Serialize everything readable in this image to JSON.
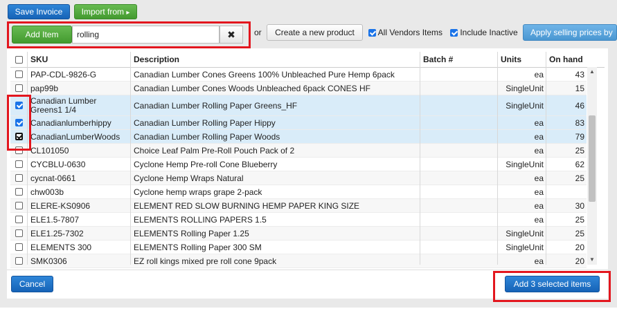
{
  "toolbar": {
    "save_invoice": "Save Invoice",
    "import_from": "Import from",
    "import_caret": "▸"
  },
  "search": {
    "add_item_label": "Add Item",
    "value": "rolling",
    "or_text": "or",
    "create_new_product": "Create a new product",
    "all_vendors_label": "All Vendors Items",
    "all_vendors_checked": true,
    "include_inactive_label": "Include Inactive",
    "include_inactive_checked": true,
    "apply_selling_prices": "Apply selling prices by"
  },
  "table": {
    "columns": [
      "SKU",
      "Description",
      "Batch #",
      "Units",
      "On hand"
    ],
    "rows": [
      {
        "sku": "PAP-CDL-9826-G",
        "description": "Canadian Lumber Cones Greens 100% Unbleached Pure Hemp 6pack",
        "batch": "",
        "units": "ea",
        "on_hand": "43",
        "checked": false,
        "selected": false
      },
      {
        "sku": "pap99b",
        "description": "Canadian Lumber Cones Woods Unbleached 6pack CONES HF",
        "batch": "",
        "units": "SingleUnit",
        "on_hand": "15",
        "checked": false,
        "selected": false
      },
      {
        "sku": "Canadian Lumber Greens1 1/4",
        "description": "Canadian Lumber Rolling Paper Greens_HF",
        "batch": "",
        "units": "SingleUnit",
        "on_hand": "46",
        "checked": true,
        "selected": true
      },
      {
        "sku": "Canadianlumberhippy",
        "description": "Canadian Lumber Rolling Paper Hippy",
        "batch": "",
        "units": "ea",
        "on_hand": "83",
        "checked": true,
        "selected": true
      },
      {
        "sku": "CanadianLumberWoods",
        "description": "Canadian Lumber Rolling Paper Woods",
        "batch": "",
        "units": "ea",
        "on_hand": "79",
        "checked": true,
        "selected": true
      },
      {
        "sku": "CL101050",
        "description": "Choice Leaf Palm Pre-Roll Pouch Pack of 2",
        "batch": "",
        "units": "ea",
        "on_hand": "25",
        "checked": false,
        "selected": false
      },
      {
        "sku": "CYCBLU-0630",
        "description": "Cyclone Hemp Pre-roll Cone Blueberry",
        "batch": "",
        "units": "SingleUnit",
        "on_hand": "62",
        "checked": false,
        "selected": false
      },
      {
        "sku": "cycnat-0661",
        "description": "Cyclone Hemp Wraps Natural",
        "batch": "",
        "units": "ea",
        "on_hand": "25",
        "checked": false,
        "selected": false
      },
      {
        "sku": "chw003b",
        "description": "Cyclone hemp wraps grape 2-pack",
        "batch": "",
        "units": "ea",
        "on_hand": "",
        "checked": false,
        "selected": false
      },
      {
        "sku": "ELERE-KS0906",
        "description": "ELEMENT RED SLOW BURNING HEMP PAPER KING SIZE",
        "batch": "",
        "units": "ea",
        "on_hand": "30",
        "checked": false,
        "selected": false
      },
      {
        "sku": "ELE1.5-7807",
        "description": "ELEMENTS ROLLING PAPERS 1.5",
        "batch": "",
        "units": "ea",
        "on_hand": "25",
        "checked": false,
        "selected": false
      },
      {
        "sku": "ELE1.25-7302",
        "description": "ELEMENTS Rolling Paper 1.25",
        "batch": "",
        "units": "SingleUnit",
        "on_hand": "25",
        "checked": false,
        "selected": false
      },
      {
        "sku": "ELEMENTS 300",
        "description": "ELEMENTS Rolling Paper 300 SM",
        "batch": "",
        "units": "SingleUnit",
        "on_hand": "20",
        "checked": false,
        "selected": false
      },
      {
        "sku": "SMK0306",
        "description": "EZ roll kings mixed pre roll cone 9pack",
        "batch": "",
        "units": "ea",
        "on_hand": "20",
        "checked": false,
        "selected": false
      }
    ]
  },
  "footer": {
    "cancel": "Cancel",
    "add_selected": "Add 3 selected items"
  },
  "colors": {
    "primary_button": "#1663b7",
    "green_button": "#439a2f",
    "selected_row": "#d9ecf9",
    "highlight_box": "#e3161e"
  }
}
